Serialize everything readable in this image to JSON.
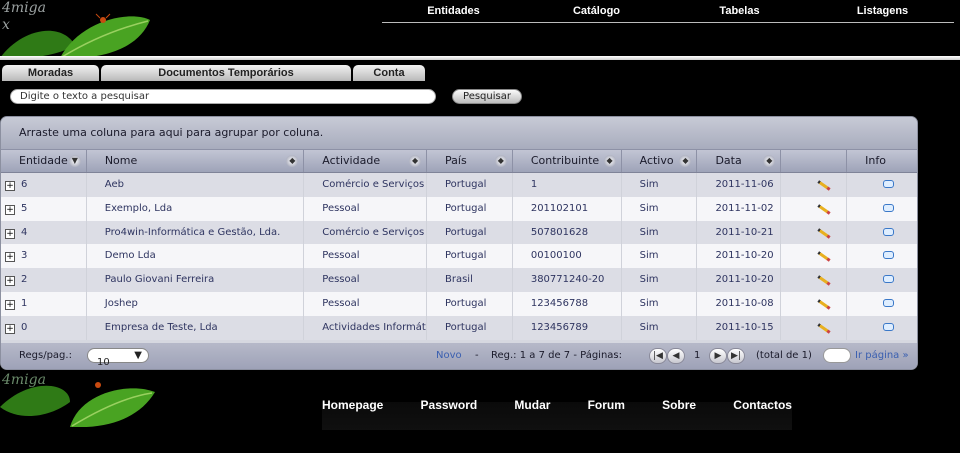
{
  "brand": {
    "logo_text_top": "4miga\nx",
    "logo_text_bottom": "4miga"
  },
  "topnav": [
    "Entidades",
    "Catálogo",
    "Tabelas",
    "Listagens"
  ],
  "tabs": [
    "Moradas",
    "Documentos Temporários",
    "Conta"
  ],
  "search": {
    "placeholder": "Digite o texto a pesquisar",
    "button": "Pesquisar"
  },
  "grid": {
    "group_hint": "Arraste uma coluna para aqui para agrupar por coluna.",
    "columns": [
      "Entidade",
      "Nome",
      "Actividade",
      "País",
      "Contribuinte",
      "Activo",
      "Data",
      "",
      "Info"
    ],
    "rows": [
      [
        "6",
        "Aeb",
        "Comércio e Serviços",
        "Portugal",
        "1",
        "Sim",
        "2011-11-06"
      ],
      [
        "5",
        "Exemplo, Lda",
        "Pessoal",
        "Portugal",
        "201102101",
        "Sim",
        "2011-11-02"
      ],
      [
        "4",
        "Pro4win-Informática e Gestão, Lda.",
        "Comércio e Serviços",
        "Portugal",
        "507801628",
        "Sim",
        "2011-10-21"
      ],
      [
        "3",
        "Demo Lda",
        "Pessoal",
        "Portugal",
        "00100100",
        "Sim",
        "2011-10-20"
      ],
      [
        "2",
        "Paulo Giovani Ferreira",
        "Pessoal",
        "Brasil",
        "380771240-20",
        "Sim",
        "2011-10-20"
      ],
      [
        "1",
        "Joshep",
        "Pessoal",
        "Portugal",
        "123456788",
        "Sim",
        "2011-10-08"
      ],
      [
        "0",
        "Empresa de Teste, Lda",
        "Actividades Informáticas",
        "Portugal",
        "123456789",
        "Sim",
        "2011-10-15"
      ]
    ],
    "edit_icon": "pencil-icon",
    "info_icon": "speech-bubble-icon"
  },
  "pager": {
    "regs_label": "Regs/pag.:",
    "regs_value": "10",
    "novo": "Novo",
    "dash": "-",
    "summary": "Reg.: 1 a 7 de 7 - Páginas:",
    "page": "1",
    "total": "(total de 1)",
    "goto": "Ir página »"
  },
  "botnav": [
    "Homepage",
    "Password",
    "Mudar",
    "Forum",
    "Sobre",
    "Contactos"
  ],
  "colors": {
    "link": "#3a5fb0",
    "leaf": "#3e8a1e"
  }
}
